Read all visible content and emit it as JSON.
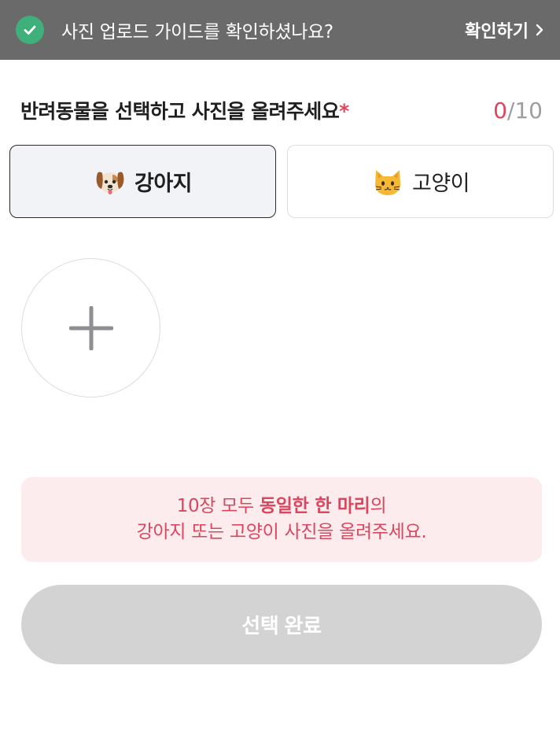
{
  "guide_banner": {
    "message": "사진 업로드 가이드를 확인하셨나요?",
    "link_label": "확인하기",
    "icon": "check-circle-icon",
    "accent_color": "#3fb07a"
  },
  "section": {
    "title": "반려동물을 선택하고 사진을 올려주세요",
    "required_mark": "*",
    "count_current": "0",
    "count_separator": "/",
    "count_max": "10"
  },
  "pet_types": [
    {
      "label": "강아지",
      "icon": "dog-face-icon",
      "selected": true
    },
    {
      "label": "고양이",
      "icon": "cat-face-icon",
      "selected": false
    }
  ],
  "add_photo": {
    "icon": "plus-icon"
  },
  "notice": {
    "line1_prefix": "10장 모두 ",
    "line1_bold": "동일한 한 마리",
    "line1_suffix": "의",
    "line2": "강아지 또는 고양이 사진을 올려주세요."
  },
  "complete_button": {
    "label": "선택 완료",
    "disabled": true
  },
  "colors": {
    "banner_bg": "#6a6a6a",
    "accent_red": "#e0455e",
    "notice_bg": "#fdecee",
    "button_disabled": "#d3d3d3"
  }
}
